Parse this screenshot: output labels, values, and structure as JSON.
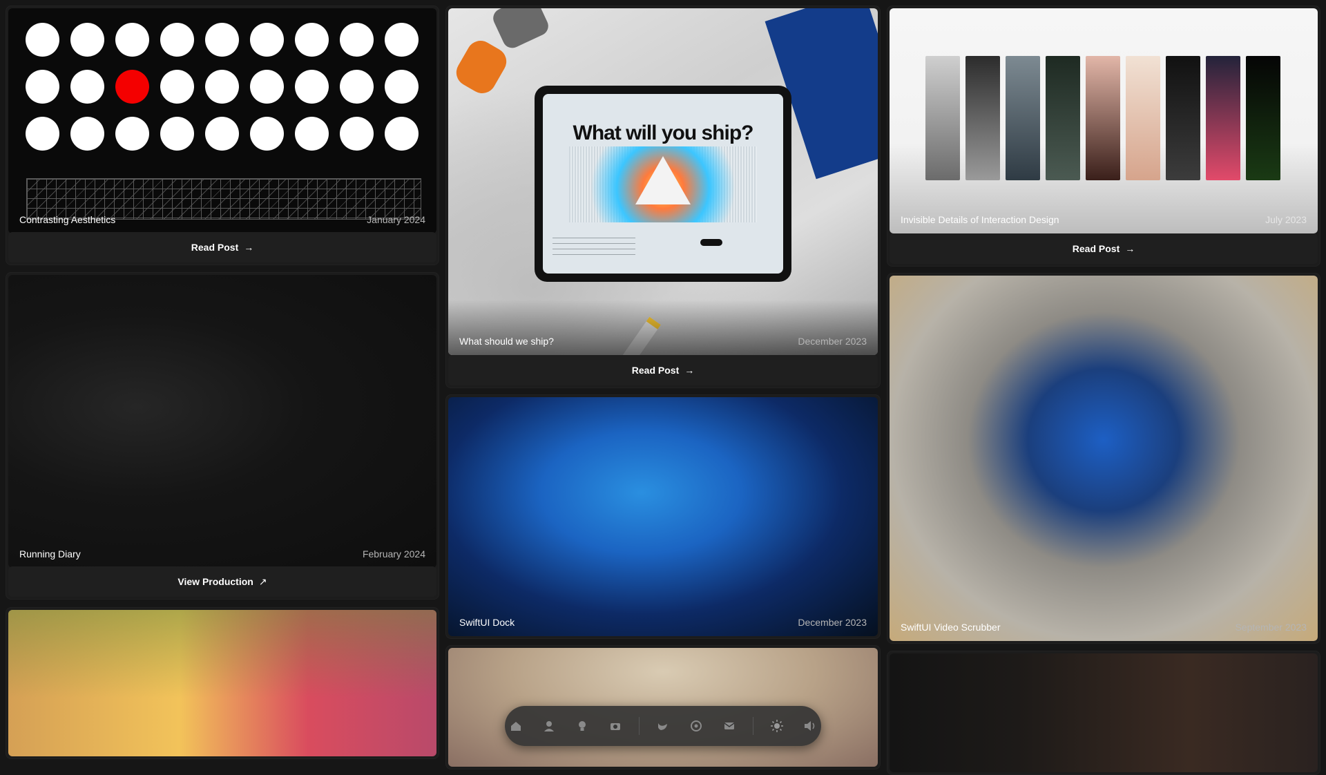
{
  "cards": {
    "contrasting": {
      "title": "Contrasting Aesthetics",
      "date": "January 2024",
      "action": "Read Post",
      "arrow": "→"
    },
    "ship": {
      "title": "What should we ship?",
      "date": "December 2023",
      "action": "Read Post",
      "arrow": "→",
      "screen_heading": "What will you ship?"
    },
    "invisible": {
      "title": "Invisible Details of Interaction Design",
      "date": "July 2023",
      "action": "Read Post",
      "arrow": "→"
    },
    "running": {
      "title": "Running Diary",
      "date": "February 2024",
      "action": "View Production",
      "arrow": "↗"
    },
    "dock": {
      "title": "SwiftUI Dock",
      "date": "December 2023"
    },
    "scrubber": {
      "title": "SwiftUI Video Scrubber",
      "date": "September 2023"
    }
  },
  "dock_icons": [
    "home-icon",
    "profile-icon",
    "lightbulb-icon",
    "camera-icon",
    "twitter-icon",
    "github-icon",
    "mail-icon",
    "brightness-icon",
    "volume-icon"
  ],
  "colors": {
    "background": "#161616",
    "accent_red": "#f40000"
  }
}
